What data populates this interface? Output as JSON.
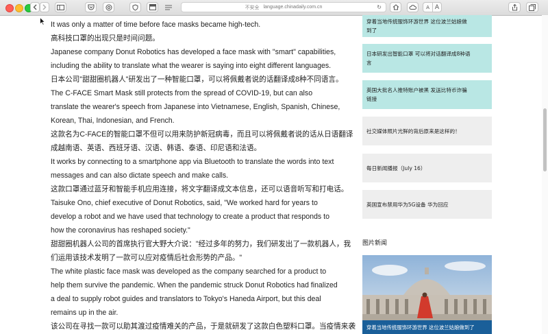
{
  "browser": {
    "security_label": "不安全",
    "url": "language.chinadaily.com.cn",
    "font_small": "A",
    "font_large": "A"
  },
  "article": {
    "paragraphs": [
      "It was only a matter of time before face masks became high-tech.",
      "高科技口罩的出现只是时间问题。",
      "Japanese company Donut Robotics has developed a face mask with \"smart\" capabilities,",
      "including the ability to translate what the wearer is saying into eight different languages.",
      "日本公司\"甜甜圈机器人\"研发出了一种智能口罩，可以将佩戴者说的话翻译成8种不同语言。",
      "The C-FACE Smart Mask still protects from the spread of COVID-19, but can also",
      "translate the wearer's speech from Japanese into Vietnamese, English, Spanish, Chinese,",
      "Korean, Thai, Indonesian, and French.",
      "这款名为C-FACE的智能口罩不但可以用来防护新冠病毒，而且可以将佩戴者说的话从日语翻译",
      "成越南语、英语、西班牙语、汉语、韩语、泰语、印尼语和法语。",
      "It works by connecting to a smartphone app via Bluetooth to translate the words into text",
      "messages and can also dictate speech and make calls.",
      "这款口罩通过蓝牙和智能手机应用连接，将文字翻译成文本信息，还可以语音听写和打电话。",
      "Taisuke Ono, chief executive of Donut Robotics, said, \"We worked hard for years to",
      "develop a robot and we have used that technology to create a product that responds to",
      "how the coronavirus has reshaped society.\"",
      "甜甜圈机器人公司的首席执行官大野大介说：\"经过多年的努力，我们研发出了一款机器人，我",
      "们运用该技术发明了一款可以应对疫情后社会形势的产品。\"",
      "The white plastic face mask was developed as the company searched for a product to",
      "help them survive the pandemic. When the pandemic struck Donut Robotics had finalized",
      "a deal to supply robot guides and translators to Tokyo's Haneda Airport, but this deal",
      "remains up in the air.",
      "该公司在寻找一款可以助其渡过疫情难关的产品，于是就研发了这款白色塑料口罩。当疫情来袭"
    ]
  },
  "sidebar": {
    "cards": [
      {
        "line1": "穿着当地传统服饰环游世界 这位波兰姑娘做",
        "line2": "到了"
      },
      {
        "line1": "日本研发出智能口罩 可以将对话翻译成8种语",
        "line2": "言"
      },
      {
        "line1": "英国大批名人推特账户被黑 发送比特币诈骗",
        "line2": "链接"
      },
      {
        "line1": "社交媒体照片光鲜的背后原来是这样的！",
        "line2": ""
      },
      {
        "line1": "每日新闻播报（July 16）",
        "line2": ""
      },
      {
        "line1": "英国宣布禁用华为5G设备 华为回应",
        "line2": ""
      }
    ],
    "section_title": "图片新闻",
    "photo_caption": "穿着当地传统服饰环游世界 这位波兰姑娘做到了"
  }
}
